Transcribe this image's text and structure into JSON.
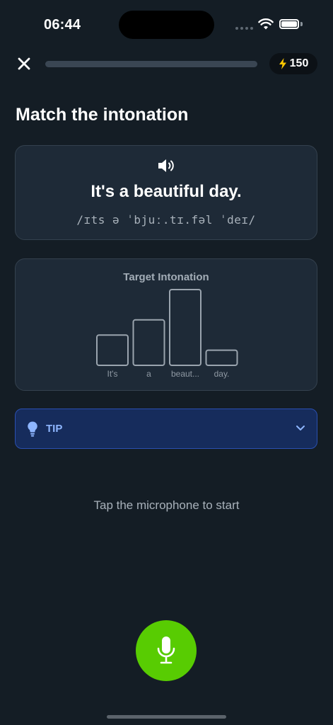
{
  "status_bar": {
    "time": "06:44"
  },
  "header": {
    "progress_fraction": 0.0,
    "xp": "150"
  },
  "title": "Match the intonation",
  "phrase_card": {
    "text": "It's a beautiful day.",
    "ipa": "/ɪts ə ˈbjuː.tɪ.fəl ˈdeɪ/"
  },
  "chart_data": {
    "type": "bar",
    "title": "Target Intonation",
    "categories": [
      "It's",
      "a",
      "beaut...",
      "day."
    ],
    "values": [
      2,
      3,
      5,
      1
    ],
    "ylim": [
      0,
      5
    ],
    "grid": false,
    "colors": {
      "bar_stroke": "#9aa4ae",
      "bar_fill": "#1e2a37"
    }
  },
  "tip": {
    "label": "TIP"
  },
  "instruction": "Tap the microphone to start",
  "colors": {
    "background": "#141d25",
    "accent": "#58cc02",
    "tip_background": "#162c5c",
    "tip_text": "#8eb6ff"
  }
}
